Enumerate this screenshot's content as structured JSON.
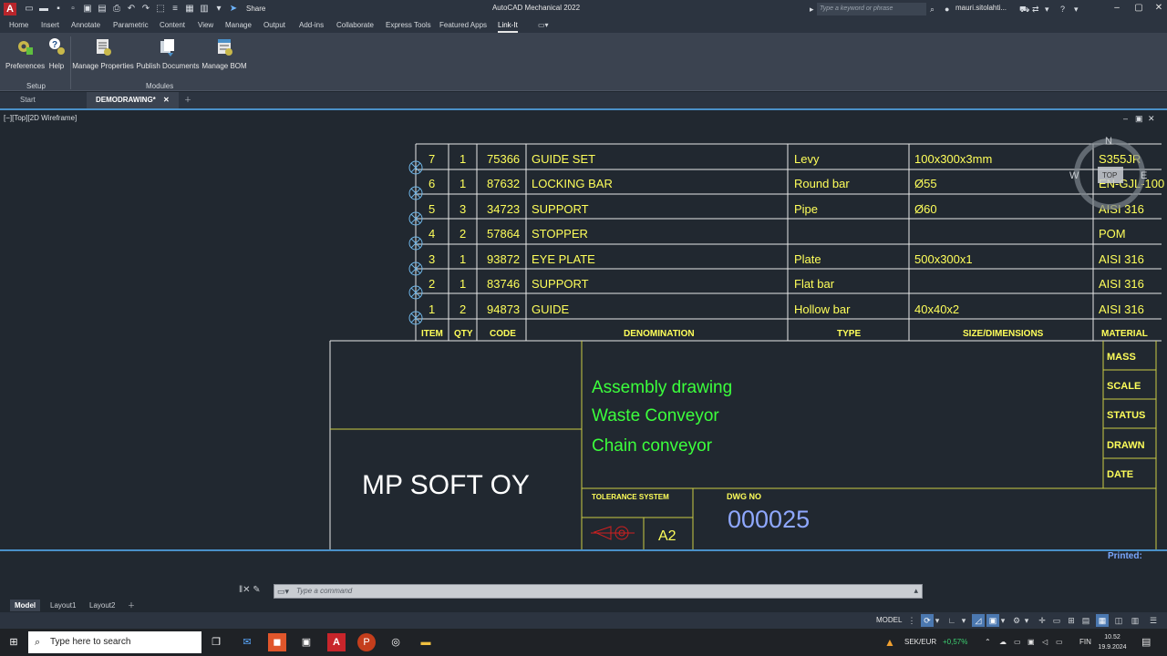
{
  "app": {
    "title": "AutoCAD Mechanical 2022",
    "logo_letter": "A",
    "search_placeholder": "Type a keyword or phrase",
    "user": "mauri.sitolahti...",
    "share_label": "Share"
  },
  "menu": {
    "tabs": [
      {
        "label": "Home"
      },
      {
        "label": "Insert"
      },
      {
        "label": "Annotate"
      },
      {
        "label": "Parametric"
      },
      {
        "label": "Content"
      },
      {
        "label": "View"
      },
      {
        "label": "Manage"
      },
      {
        "label": "Output"
      },
      {
        "label": "Add-ins"
      },
      {
        "label": "Collaborate"
      },
      {
        "label": "Express Tools"
      },
      {
        "label": "Featured Apps"
      },
      {
        "label": "Link-It"
      }
    ],
    "active_tab": "Link-It"
  },
  "ribbon": {
    "buttons": [
      {
        "label": "Preferences"
      },
      {
        "label": "Help"
      },
      {
        "label": "Manage Properties"
      },
      {
        "label": "Publish Documents"
      },
      {
        "label": "Manage BOM"
      }
    ],
    "panels": [
      {
        "label": "Setup"
      },
      {
        "label": "Modules"
      }
    ]
  },
  "file_tabs": [
    {
      "label": "Start"
    },
    {
      "label": "DEMODRAWING*"
    }
  ],
  "viewport": {
    "label": "[−][Top][2D Wireframe]",
    "printed_label": "Printed:"
  },
  "viewcube": {
    "north": "N",
    "west": "W",
    "east": "E",
    "top": "TOP"
  },
  "bom": {
    "headers": [
      "ITEM",
      "QTY",
      "CODE",
      "DENOMINATION",
      "TYPE",
      "SIZE/DIMENSIONS",
      "MATERIAL"
    ],
    "rows": [
      {
        "item": "7",
        "qty": "1",
        "code": "75366",
        "denomination": "GUIDE SET",
        "type": "Levy",
        "size": "100x300x3mm",
        "material": "S355JR"
      },
      {
        "item": "6",
        "qty": "1",
        "code": "87632",
        "denomination": "LOCKING BAR",
        "type": "Round bar",
        "size": "Ø55",
        "material": "EN-GJL-100"
      },
      {
        "item": "5",
        "qty": "3",
        "code": "34723",
        "denomination": "SUPPORT",
        "type": "Pipe",
        "size": "Ø60",
        "material": "AISI 316"
      },
      {
        "item": "4",
        "qty": "2",
        "code": "57864",
        "denomination": "STOPPER",
        "type": "",
        "size": "",
        "material": "POM"
      },
      {
        "item": "3",
        "qty": "1",
        "code": "93872",
        "denomination": "EYE PLATE",
        "type": "Plate",
        "size": "500x300x1",
        "material": "AISI 316"
      },
      {
        "item": "2",
        "qty": "1",
        "code": "83746",
        "denomination": "SUPPORT",
        "type": "Flat bar",
        "size": "",
        "material": "AISI 316"
      },
      {
        "item": "1",
        "qty": "2",
        "code": "94873",
        "denomination": "GUIDE",
        "type": "Hollow bar",
        "size": "40x40x2",
        "material": "AISI 316"
      }
    ]
  },
  "titleblock": {
    "company": "MP SOFT OY",
    "title_lines": [
      "Assembly drawing",
      "Waste Conveyor",
      "Chain conveyor"
    ],
    "fields": [
      "MASS",
      "SCALE",
      "STATUS",
      "DRAWN",
      "DATE"
    ],
    "tolerance_label": "TOLERANCE SYSTEM",
    "sheet_size": "A2",
    "dwg_label": "DWG NO",
    "dwg_number": "000025"
  },
  "command": {
    "placeholder": "Type a command"
  },
  "layout_tabs": [
    {
      "label": "Model"
    },
    {
      "label": "Layout1"
    },
    {
      "label": "Layout2"
    }
  ],
  "status": {
    "model_label": "MODEL"
  },
  "taskbar": {
    "search_placeholder": "Type here to search",
    "currency": "SEK/EUR",
    "change": "+0,57%",
    "language": "FIN",
    "time": "10.52",
    "date": "19.9.2024"
  },
  "colors": {
    "cad_yellow": "#ffff5a",
    "cad_green": "#3cff3c",
    "accent_blue": "#4a90c8",
    "dwg_blue": "#8fa8ff"
  }
}
